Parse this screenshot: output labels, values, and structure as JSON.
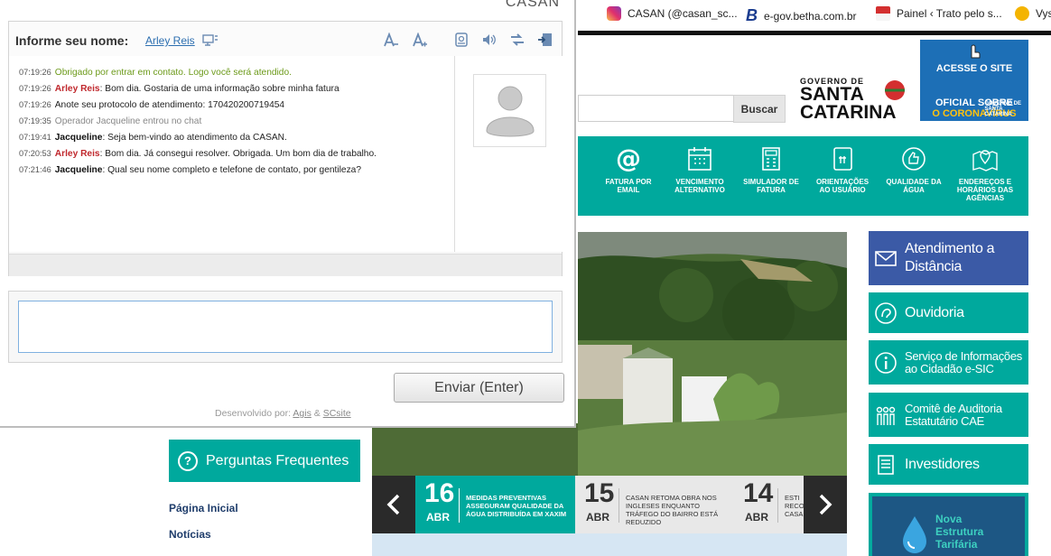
{
  "bookmarks": [
    {
      "label": "CASAN (@casan_sc...",
      "icon": "instagram-icon"
    },
    {
      "label": "e-gov.betha.com.br",
      "icon": "betha-icon"
    },
    {
      "label": "Painel ‹ Trato pelo s...",
      "icon": "flag-icon"
    },
    {
      "label": "Vys",
      "icon": "app-icon"
    }
  ],
  "header": {
    "search_button": "Buscar",
    "gov_logo": {
      "line1": "GOVERNO DE",
      "line2": "SANTA",
      "line3": "CATARINA"
    },
    "corona_banner": {
      "line1": "ACESSE O SITE",
      "line2": "OFICIAL SOBRE",
      "line3": "O CORONAVÍRUS",
      "badge_line1": "GOVERNO DE",
      "badge_line2": "SANTA",
      "badge_line3": "CATARINA"
    }
  },
  "nav": [
    {
      "label": "FATURA POR EMAIL",
      "icon": "at-icon"
    },
    {
      "label": "VENCIMENTO ALTERNATIVO",
      "icon": "calendar-icon"
    },
    {
      "label": "SIMULADOR DE FATURA",
      "icon": "calculator-icon"
    },
    {
      "label": "ORIENTAÇÕES AO USUÁRIO",
      "icon": "book-icon"
    },
    {
      "label": "QUALIDADE DA ÁGUA",
      "icon": "thumbs-up-icon"
    },
    {
      "label": "ENDEREÇOS E HORÁRIOS DAS AGÊNCIAS",
      "icon": "map-pin-icon"
    }
  ],
  "news": [
    {
      "day": "16",
      "month": "ABR",
      "title": "MEDIDAS PREVENTIVAS ASSEGURAM QUALIDADE DA ÁGUA DISTRIBUÍDA EM XAXIM"
    },
    {
      "day": "15",
      "month": "ABR",
      "title": "CASAN RETOMA OBRA NOS INGLESES ENQUANTO TRÁFEGO DO BAIRRO ESTÁ REDUZIDO"
    },
    {
      "day": "14",
      "month": "ABR",
      "title": "ESTI RECO CASA"
    }
  ],
  "left_menu": {
    "faq": "Perguntas Frequentes",
    "links": [
      "Página Inicial",
      "Notícias"
    ]
  },
  "right_menu": [
    {
      "label": "Atendimento a Distância",
      "icon": "envelope-icon"
    },
    {
      "label": "Ouvidoria",
      "icon": "ear-icon"
    },
    {
      "label": "Serviço de Informações ao Cidadão e-SIC",
      "icon": "info-icon"
    },
    {
      "label": "Comitê de Auditoria Estatutário CAE",
      "icon": "people-icon"
    },
    {
      "label": "Investidores",
      "icon": "document-icon"
    }
  ],
  "tarifa": {
    "line1": "Nova",
    "line2": "Estrutura",
    "line3": "Tarifária"
  },
  "chat": {
    "brand": "CASAN",
    "name_label": "Informe seu nome:",
    "user_name": "Arley Reis",
    "messages": [
      {
        "time": "07:19:26",
        "sender": "",
        "text": "Obrigado por entrar em contato. Logo você será atendido."
      },
      {
        "time": "07:19:26",
        "sender": "Arley Reis",
        "text": ": Bom dia. Gostaria de uma informação sobre minha fatura"
      },
      {
        "time": "07:19:26",
        "sender": "",
        "text": "Anote seu protocolo de atendimento: 170420200719454"
      },
      {
        "time": "07:19:35",
        "sender": "",
        "text": "Operador Jacqueline entrou no chat"
      },
      {
        "time": "07:19:41",
        "sender": "Jacqueline",
        "text": ": Seja bem-vindo ao atendimento da CASAN."
      },
      {
        "time": "07:20:53",
        "sender": "Arley Reis",
        "text": ": Bom dia. Já consegui resolver. Obrigada. Um bom dia de trabalho."
      },
      {
        "time": "07:21:46",
        "sender": "Jacqueline",
        "text": ": Qual seu nome completo e telefone de contato, por gentileza?"
      }
    ],
    "input_value": "",
    "send_button": "Enviar (Enter)",
    "dev_prefix": "Desenvolvido por:",
    "dev_link1": "Agis",
    "dev_amp": "&",
    "dev_link2": "SCsite"
  }
}
